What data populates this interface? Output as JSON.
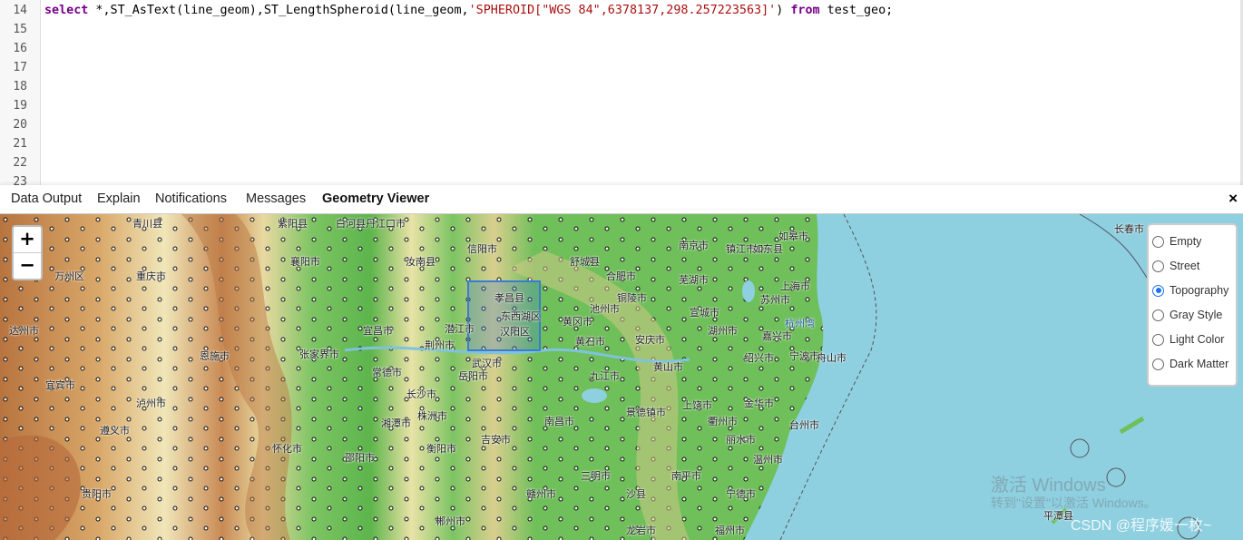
{
  "editor": {
    "line_numbers": [
      "14",
      "15",
      "16",
      "17",
      "18",
      "19",
      "20",
      "21",
      "22",
      "23"
    ],
    "sql": {
      "kw_select": "select",
      "part1": " *,ST_AsText(line_geom),ST_LengthSpheroid(line_geom,",
      "string_arg": "'SPHEROID[\"WGS 84\",6378137,298.257223563]'",
      "part2": ") ",
      "kw_from": "from",
      "part3": " test_geo;"
    }
  },
  "tabs": [
    {
      "label": "Data Output"
    },
    {
      "label": "Explain"
    },
    {
      "label": "Notifications"
    },
    {
      "label": "Messages"
    },
    {
      "label": "Geometry Viewer",
      "active": true
    }
  ],
  "close_symbol": "×",
  "map": {
    "zoom_in": "+",
    "zoom_out": "−",
    "layers": [
      {
        "label": "Empty",
        "selected": false
      },
      {
        "label": "Street",
        "selected": false
      },
      {
        "label": "Topography",
        "selected": true
      },
      {
        "label": "Gray Style",
        "selected": false
      },
      {
        "label": "Light Color",
        "selected": false
      },
      {
        "label": "Dark Matter",
        "selected": false
      }
    ],
    "place_labels": [
      "青川县",
      "紫阳县",
      "白河县",
      "丹江口市",
      "襄阳市",
      "汝南县",
      "信阳市",
      "舒城县",
      "南京市",
      "镇江市",
      "如东县",
      "如皋市",
      "上海市",
      "苏州市",
      "嘉兴市",
      "杭州湾",
      "宁波市",
      "合肥市",
      "芜湖市",
      "孝昌县",
      "东西湖区",
      "汉阳区",
      "武汉市",
      "黄石市",
      "九江市",
      "南昌市",
      "景德镇市",
      "上饶市",
      "衢州市",
      "金华市",
      "温州市",
      "台州市",
      "丽水市",
      "福州市",
      "龙岩市",
      "赣州市",
      "吉安市",
      "长沙市",
      "岳阳市",
      "常德市",
      "张家界市",
      "怀化市",
      "邵阳市",
      "衡阳市",
      "郴州市",
      "株洲市",
      "湘潭市",
      "重庆市",
      "遵义市",
      "贵阳市",
      "宜宾市",
      "泸州市",
      "达州市",
      "万州区",
      "恩施市",
      "宜昌市",
      "荆州市",
      "潜江市",
      "黄冈市",
      "安庆市",
      "铜陵市",
      "池州市",
      "黄山市",
      "宣城市",
      "湖州市",
      "绍兴市",
      "舟山市",
      "长春市",
      "平潭县",
      "宁德市",
      "南平市",
      "三明市",
      "沙县"
    ],
    "watermark_activate": "激活 Windows",
    "watermark_settings": "转到\"设置\"以激活 Windows。",
    "watermark_csdn": "CSDN @程序媛一枚~"
  },
  "colors": {
    "sea": "#8ecfe0",
    "lowland": "#6fbf5a",
    "plain": "#e8e2a8",
    "highland": "#c98a55",
    "selection": "#3a7bd5"
  }
}
